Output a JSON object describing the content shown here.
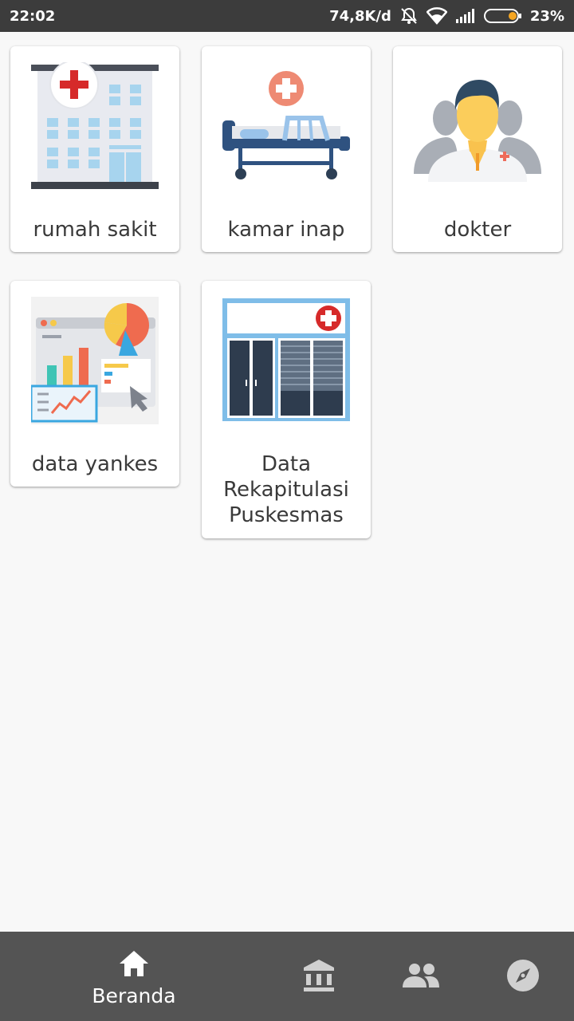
{
  "status_bar": {
    "time": "22:02",
    "network_speed": "74,8K/d",
    "battery_percent": "23%",
    "battery_level": 0.23,
    "icons": [
      "alarm-off-icon",
      "wifi-icon",
      "signal-icon",
      "battery-icon"
    ]
  },
  "menu": {
    "items": [
      {
        "label": "rumah sakit",
        "icon": "hospital-building-icon"
      },
      {
        "label": "kamar inap",
        "icon": "hospital-bed-icon"
      },
      {
        "label": "dokter",
        "icon": "doctor-icon"
      },
      {
        "label": "data yankes",
        "icon": "data-analytics-icon"
      },
      {
        "label_lines": [
          "Data",
          "Rekapitulasi",
          "Puskesmas"
        ],
        "icon": "puskesmas-building-icon"
      }
    ]
  },
  "bottom_nav": {
    "items": [
      {
        "label": "Beranda",
        "icon": "home-icon",
        "active": true
      },
      {
        "icon": "institution-icon",
        "active": false
      },
      {
        "icon": "people-icon",
        "active": false
      },
      {
        "icon": "compass-icon",
        "active": false
      }
    ]
  },
  "colors": {
    "status_bar_bg": "#3c3c3c",
    "page_bg": "#f8f8f8",
    "card_bg": "#ffffff",
    "label_text": "#3a3a3a",
    "bottom_nav_bg": "#545454",
    "bottom_nav_active": "#ffffff",
    "bottom_nav_inactive": "#d0d0d0",
    "battery_fill": "#f5a623"
  }
}
